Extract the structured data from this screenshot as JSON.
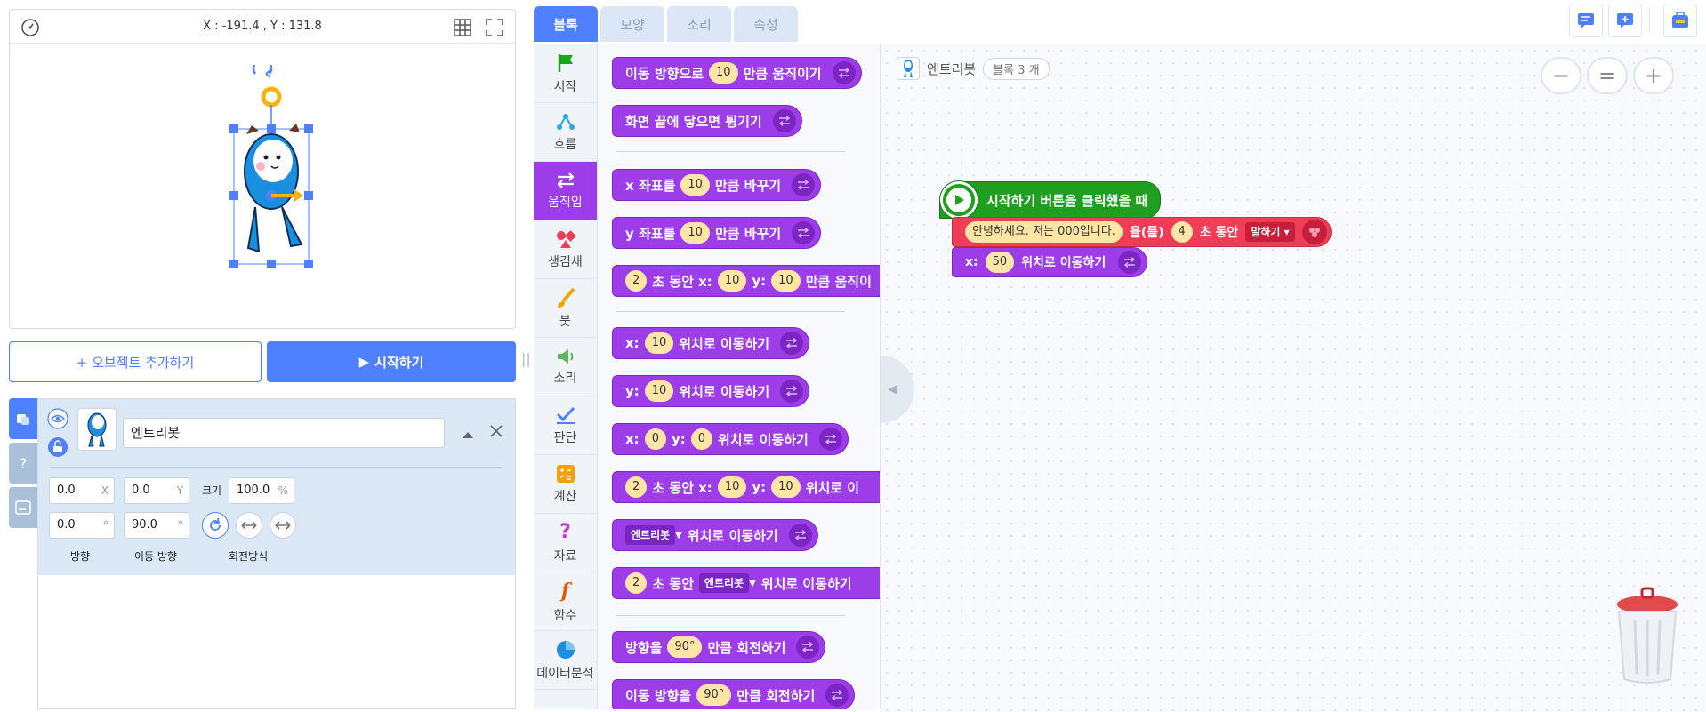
{
  "stage": {
    "coord_text": "X : -191.4 , Y : 131.8"
  },
  "buttons": {
    "add_object": "+ 오브젝트 추가하기",
    "start": "시작하기",
    "start_icon": "▶"
  },
  "object": {
    "name": "엔트리봇",
    "x": "0.0",
    "x_suffix": "X",
    "y": "0.0",
    "y_suffix": "Y",
    "size_label": "크기",
    "size": "100.0",
    "size_suffix": "%",
    "direction": "0.0",
    "direction_suffix": "°",
    "move_direction": "90.0",
    "move_direction_suffix": "°",
    "direction_label": "방향",
    "move_direction_label": "이동 방향",
    "rotation_label": "회전방식"
  },
  "tabs": [
    "블록",
    "모양",
    "소리",
    "속성"
  ],
  "categories": [
    {
      "label": "시작",
      "icon": "flag-icon"
    },
    {
      "label": "흐름",
      "icon": "flow-icon"
    },
    {
      "label": "움직임",
      "icon": "move-icon"
    },
    {
      "label": "생김새",
      "icon": "looks-icon"
    },
    {
      "label": "붓",
      "icon": "brush-icon"
    },
    {
      "label": "소리",
      "icon": "speaker-icon"
    },
    {
      "label": "판단",
      "icon": "check-icon"
    },
    {
      "label": "계산",
      "icon": "calculator-icon"
    },
    {
      "label": "자료",
      "icon": "question-icon"
    },
    {
      "label": "함수",
      "icon": "function-icon"
    },
    {
      "label": "데이터분석",
      "icon": "pie-chart-icon"
    }
  ],
  "palette": {
    "b1": {
      "a": "이동 방향으로",
      "v": "10",
      "b": "만큼 움직이기"
    },
    "b2": {
      "a": "화면 끝에 닿으면 튕기기"
    },
    "b3": {
      "a": "x 좌표를",
      "v": "10",
      "b": "만큼 바꾸기"
    },
    "b4": {
      "a": "y 좌표를",
      "v": "10",
      "b": "만큼 바꾸기"
    },
    "b5": {
      "v1": "2",
      "a": "초 동안 x:",
      "v2": "10",
      "b": "y:",
      "v3": "10",
      "c": "만큼 움직이"
    },
    "b6": {
      "a": "x:",
      "v": "10",
      "b": "위치로 이동하기"
    },
    "b7": {
      "a": "y:",
      "v": "10",
      "b": "위치로 이동하기"
    },
    "b8": {
      "a": "x:",
      "v1": "0",
      "b": "y:",
      "v2": "0",
      "c": "위치로 이동하기"
    },
    "b9": {
      "v1": "2",
      "a": "초 동안 x:",
      "v2": "10",
      "b": "y:",
      "v3": "10",
      "c": "위치로 이"
    },
    "b10": {
      "d": "엔트리봇",
      "a": "위치로 이동하기"
    },
    "b11": {
      "v": "2",
      "a": "초 동안",
      "d": "엔트리봇",
      "b": "위치로 이동하기"
    },
    "b12": {
      "a": "방향을",
      "v": "90°",
      "b": "만큼 회전하기"
    },
    "b13": {
      "a": "이동 방향을",
      "v": "90°",
      "b": "만큼 회전하기"
    }
  },
  "workspace": {
    "object_name": "엔트리봇",
    "block_count": "블록 3 개",
    "zoom": [
      "−",
      "=",
      "+"
    ],
    "start_block": "시작하기 버튼을 클릭했을 때",
    "say": {
      "text": "안녕하세요. 저는 000입니다.",
      "a": "을(를)",
      "secs": "4",
      "b": "초 동안",
      "mode": "말하기 ▾"
    },
    "move": {
      "a": "x:",
      "v": "50",
      "b": "위치로 이동하기"
    }
  },
  "colors": {
    "accent": "#4f80ff",
    "motion": "#9d3ce9",
    "start": "#1f9e1f",
    "looks": "#ee3d56"
  }
}
